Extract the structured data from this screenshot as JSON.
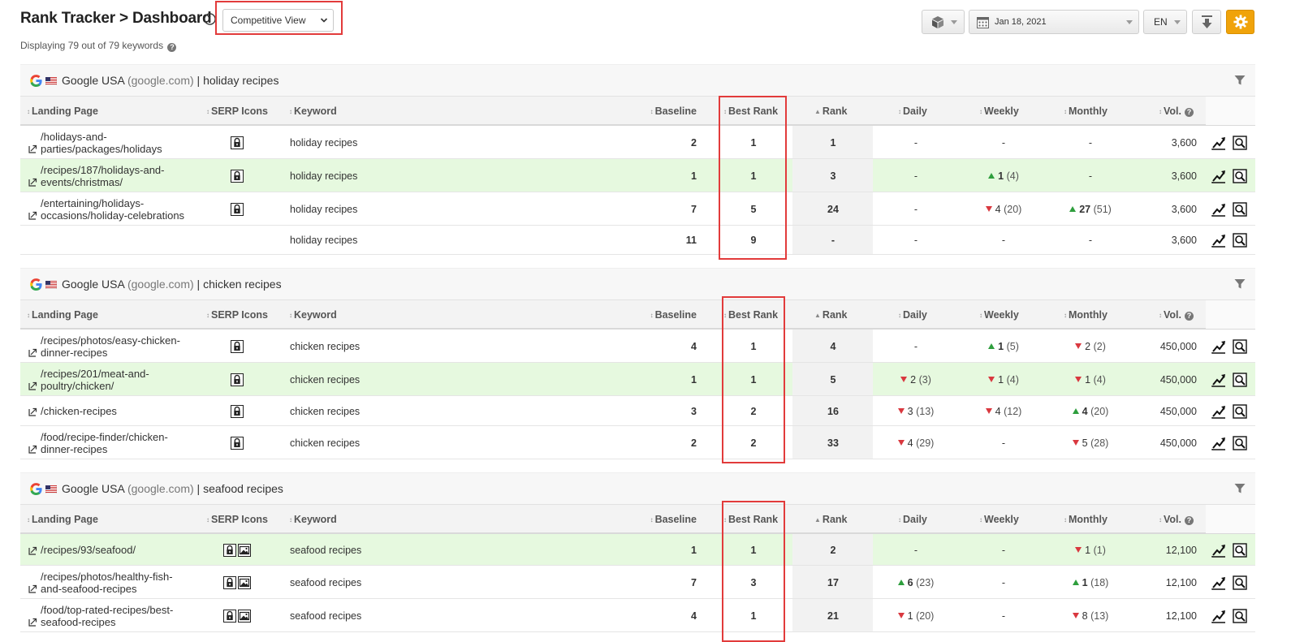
{
  "header": {
    "title": "Rank Tracker > Dashboard",
    "view_select": "Competitive View",
    "displaying": "Displaying 79 out of 79 keywords",
    "date": "Jan 18, 2021",
    "language": "EN"
  },
  "colors": {
    "accent": "#f0a30a",
    "highlight": "#e6f9df",
    "callout": "#e23b3b",
    "up": "#2e9e3d",
    "down": "#d9383f"
  },
  "columns": {
    "landing_page": "Landing Page",
    "serp_icons": "SERP Icons",
    "keyword": "Keyword",
    "baseline": "Baseline",
    "best_rank": "Best Rank",
    "rank": "Rank",
    "daily": "Daily",
    "weekly": "Weekly",
    "monthly": "Monthly",
    "vol": "Vol."
  },
  "groups": [
    {
      "engine": "Google USA",
      "domain": "(google.com)",
      "separator": "|",
      "keyword": "holiday recipes",
      "rows": [
        {
          "landing": [
            "/holidays-and-",
            "parties/packages/holidays"
          ],
          "icons": [
            "lock-icon"
          ],
          "keyword": "holiday recipes",
          "baseline": "2",
          "best": "1",
          "rank": "1",
          "daily": {
            "dir": "none",
            "text": "-"
          },
          "weekly": {
            "dir": "none",
            "text": "-"
          },
          "monthly": {
            "dir": "none",
            "text": "-"
          },
          "vol": "3,600",
          "hl": false
        },
        {
          "landing": [
            "/recipes/187/holidays-and-",
            "events/christmas/"
          ],
          "icons": [
            "lock-icon"
          ],
          "keyword": "holiday recipes",
          "baseline": "1",
          "best": "1",
          "rank": "3",
          "daily": {
            "dir": "none",
            "text": "-"
          },
          "weekly": {
            "dir": "up",
            "value": "1",
            "sub": "(4)"
          },
          "monthly": {
            "dir": "none",
            "text": "-"
          },
          "vol": "3,600",
          "hl": true
        },
        {
          "landing": [
            "/entertaining/holidays-",
            "occasions/holiday-celebrations"
          ],
          "icons": [
            "lock-icon"
          ],
          "keyword": "holiday recipes",
          "baseline": "7",
          "best": "5",
          "rank": "24",
          "daily": {
            "dir": "none",
            "text": "-"
          },
          "weekly": {
            "dir": "down",
            "value": "4",
            "sub": "(20)"
          },
          "monthly": {
            "dir": "up",
            "value": "27",
            "sub": "(51)"
          },
          "vol": "3,600",
          "hl": false
        },
        {
          "landing": [],
          "icons": [],
          "keyword": "holiday recipes",
          "baseline": "11",
          "best": "9",
          "rank": "-",
          "daily": {
            "dir": "none",
            "text": "-"
          },
          "weekly": {
            "dir": "none",
            "text": "-"
          },
          "monthly": {
            "dir": "none",
            "text": "-"
          },
          "vol": "3,600",
          "hl": false
        }
      ]
    },
    {
      "engine": "Google USA",
      "domain": "(google.com)",
      "separator": "|",
      "keyword": "chicken recipes",
      "rows": [
        {
          "landing": [
            "/recipes/photos/easy-chicken-",
            "dinner-recipes"
          ],
          "icons": [
            "lock-icon"
          ],
          "keyword": "chicken recipes",
          "baseline": "4",
          "best": "1",
          "rank": "4",
          "daily": {
            "dir": "none",
            "text": "-"
          },
          "weekly": {
            "dir": "up",
            "value": "1",
            "sub": "(5)"
          },
          "monthly": {
            "dir": "down",
            "value": "2",
            "sub": "(2)"
          },
          "vol": "450,000",
          "hl": false
        },
        {
          "landing": [
            "/recipes/201/meat-and-",
            "poultry/chicken/"
          ],
          "icons": [
            "lock-icon"
          ],
          "keyword": "chicken recipes",
          "baseline": "1",
          "best": "1",
          "rank": "5",
          "daily": {
            "dir": "down",
            "value": "2",
            "sub": "(3)"
          },
          "weekly": {
            "dir": "down",
            "value": "1",
            "sub": "(4)"
          },
          "monthly": {
            "dir": "down",
            "value": "1",
            "sub": "(4)"
          },
          "vol": "450,000",
          "hl": true
        },
        {
          "landing": [
            "/chicken-recipes"
          ],
          "icons": [
            "lock-icon"
          ],
          "keyword": "chicken recipes",
          "baseline": "3",
          "best": "2",
          "rank": "16",
          "daily": {
            "dir": "down",
            "value": "3",
            "sub": "(13)"
          },
          "weekly": {
            "dir": "down",
            "value": "4",
            "sub": "(12)"
          },
          "monthly": {
            "dir": "up",
            "value": "4",
            "sub": "(20)"
          },
          "vol": "450,000",
          "hl": false
        },
        {
          "landing": [
            "/food/recipe-finder/chicken-",
            "dinner-recipes"
          ],
          "icons": [
            "lock-icon"
          ],
          "keyword": "chicken recipes",
          "baseline": "2",
          "best": "2",
          "rank": "33",
          "daily": {
            "dir": "down",
            "value": "4",
            "sub": "(29)"
          },
          "weekly": {
            "dir": "none",
            "text": "-"
          },
          "monthly": {
            "dir": "down",
            "value": "5",
            "sub": "(28)"
          },
          "vol": "450,000",
          "hl": false
        }
      ]
    },
    {
      "engine": "Google USA",
      "domain": "(google.com)",
      "separator": "|",
      "keyword": "seafood recipes",
      "rows": [
        {
          "landing": [
            "/recipes/93/seafood/"
          ],
          "icons": [
            "lock-icon",
            "image-icon"
          ],
          "keyword": "seafood recipes",
          "baseline": "1",
          "best": "1",
          "rank": "2",
          "daily": {
            "dir": "none",
            "text": "-"
          },
          "weekly": {
            "dir": "none",
            "text": "-"
          },
          "monthly": {
            "dir": "down",
            "value": "1",
            "sub": "(1)"
          },
          "vol": "12,100",
          "hl": true
        },
        {
          "landing": [
            "/recipes/photos/healthy-fish-",
            "and-seafood-recipes"
          ],
          "icons": [
            "lock-icon",
            "image-icon"
          ],
          "keyword": "seafood recipes",
          "baseline": "7",
          "best": "3",
          "rank": "17",
          "daily": {
            "dir": "up",
            "value": "6",
            "sub": "(23)"
          },
          "weekly": {
            "dir": "none",
            "text": "-"
          },
          "monthly": {
            "dir": "up",
            "value": "1",
            "sub": "(18)"
          },
          "vol": "12,100",
          "hl": false
        },
        {
          "landing": [
            "/food/top-rated-recipes/best-",
            "seafood-recipes"
          ],
          "icons": [
            "lock-icon",
            "image-icon"
          ],
          "keyword": "seafood recipes",
          "baseline": "4",
          "best": "1",
          "rank": "21",
          "daily": {
            "dir": "down",
            "value": "1",
            "sub": "(20)"
          },
          "weekly": {
            "dir": "none",
            "text": "-"
          },
          "monthly": {
            "dir": "down",
            "value": "8",
            "sub": "(13)"
          },
          "vol": "12,100",
          "hl": false
        }
      ]
    }
  ]
}
